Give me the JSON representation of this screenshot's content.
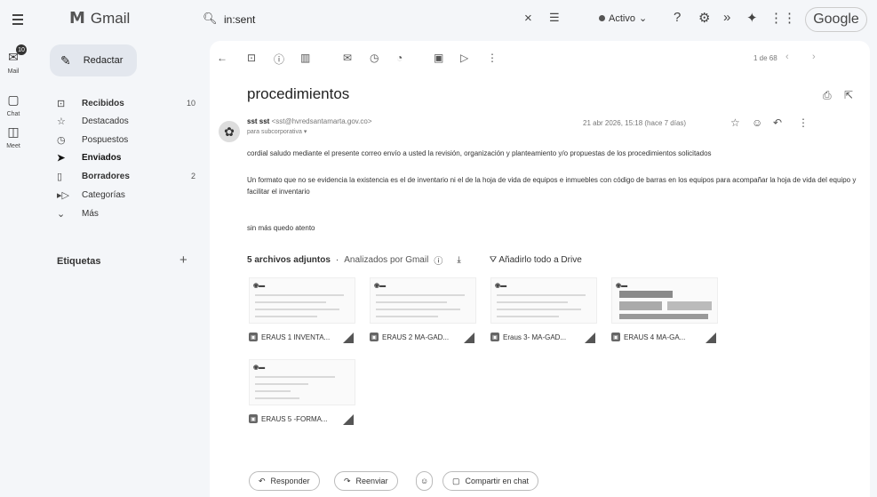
{
  "topbar": {
    "app_name": "Gmail",
    "search_query": "in:sent",
    "status": "Activo",
    "account_brand": "Google"
  },
  "rail": {
    "mail_label": "Mail",
    "mail_badge": "10",
    "chat_label": "Chat",
    "meet_label": "Meet"
  },
  "sidebar": {
    "compose_label": "Redactar",
    "items": [
      {
        "label": "Recibidos",
        "count": "10",
        "icon": "inbox-icon"
      },
      {
        "label": "Destacados",
        "count": "",
        "icon": "star-icon"
      },
      {
        "label": "Pospuestos",
        "count": "",
        "icon": "clock-icon"
      },
      {
        "label": "Enviados",
        "count": "",
        "icon": "send-icon"
      },
      {
        "label": "Borradores",
        "count": "2",
        "icon": "draft-icon"
      },
      {
        "label": "Categorías",
        "count": "",
        "icon": "label-icon"
      },
      {
        "label": "Más",
        "count": "",
        "icon": "chevron-down-icon"
      }
    ],
    "labels_heading": "Etiquetas"
  },
  "toolbar": {
    "pager": "1 de 68"
  },
  "email": {
    "subject": "procedimientos",
    "sender_name": "sst sst",
    "sender_email": "<sst@hvredsantamarta.gov.co>",
    "to": "para subcorporativa",
    "date": "21 abr 2026, 15:18 (hace 7 días)",
    "body": [
      "cordial saludo mediante el presente correo envío a usted la revisión, organización y planteamiento y/o propuestas de los procedimientos solicitados",
      "Un formato que no se evidencia la existencia es el de inventario ni el de la hoja de vida de equipos e inmuebles con código de barras en los equipos para acompañar la hoja de vida del equipo y facilitar el inventario",
      "sin más quedo atento"
    ]
  },
  "attachments": {
    "heading": "5 archivos adjuntos",
    "scanned": "Analizados por Gmail",
    "drive": "Añadirlo todo a Drive",
    "files": [
      {
        "name": "ERAUS 1 INVENTA..."
      },
      {
        "name": "ERAUS 2 MA-GAD..."
      },
      {
        "name": "Eraus 3- MA-GAD..."
      },
      {
        "name": "ERAUS 4 MA-GA..."
      },
      {
        "name": "ERAUS 5 -FORMA..."
      }
    ]
  },
  "actions": {
    "reply": "Responder",
    "forward": "Reenviar",
    "share_chat": "Compartir en chat"
  }
}
